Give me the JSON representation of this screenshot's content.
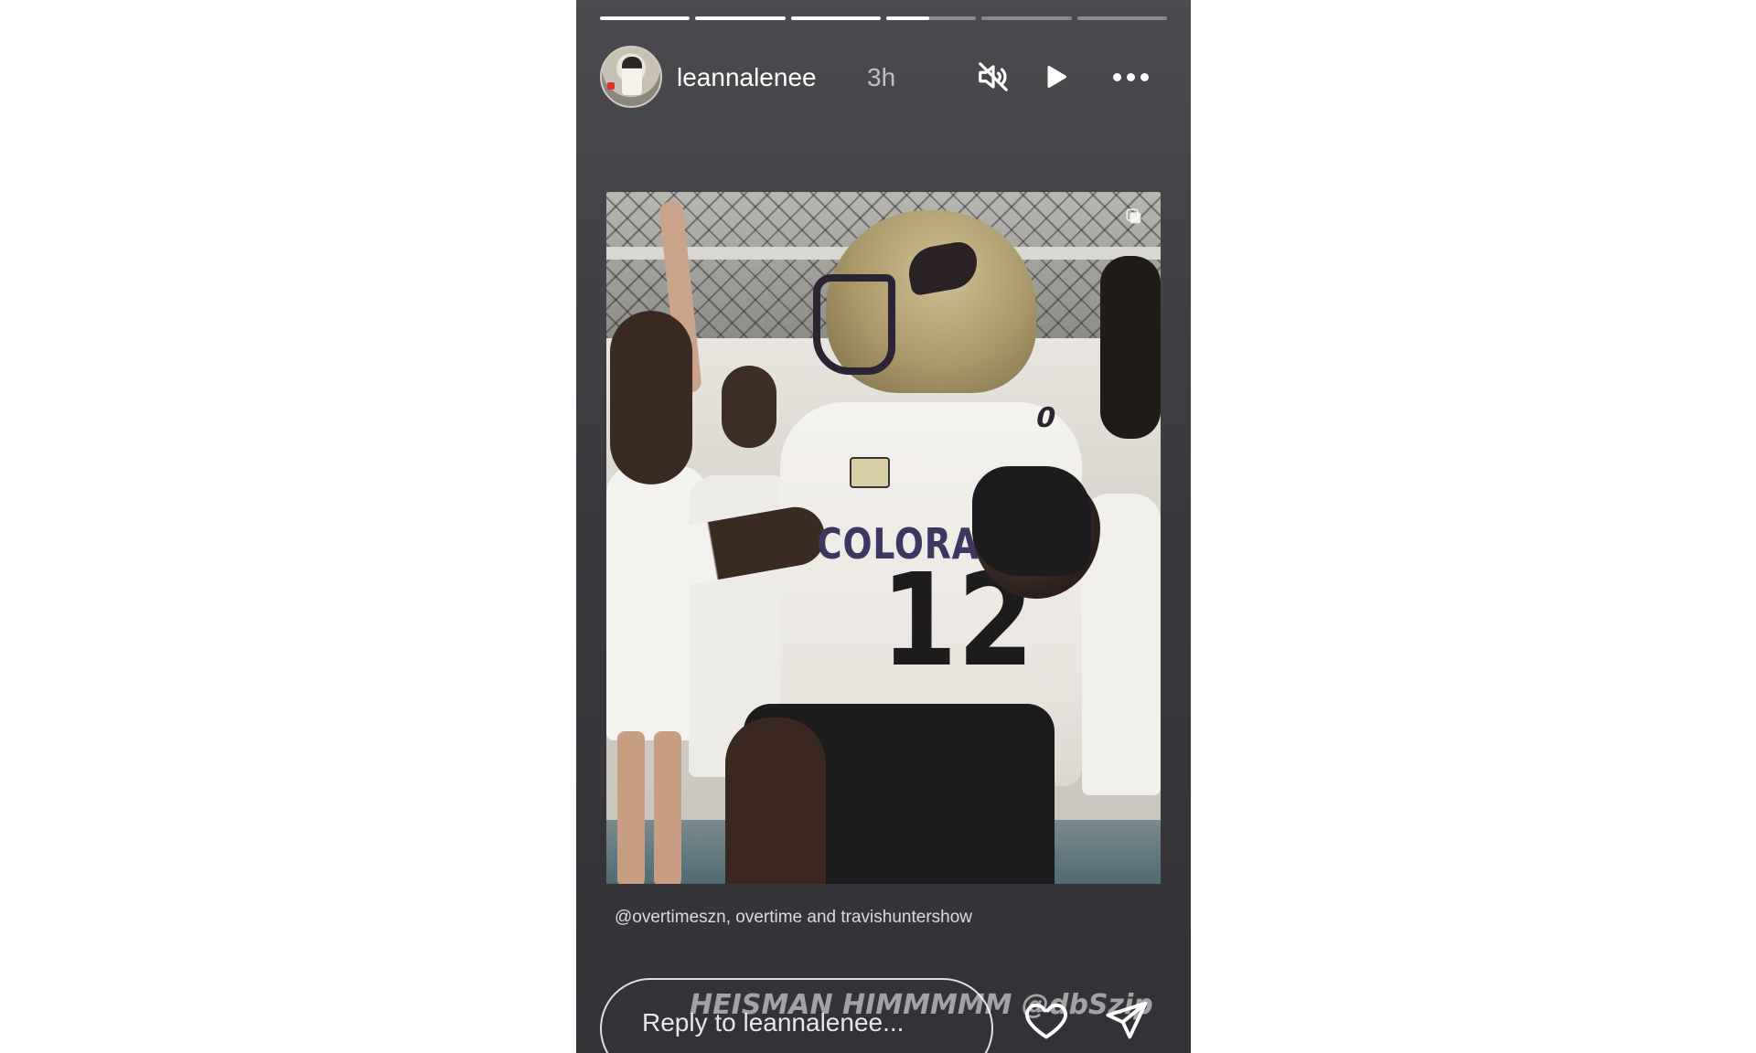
{
  "story": {
    "progress": [
      1,
      1,
      1,
      0.48,
      0,
      0
    ],
    "author": {
      "username": "leannalenee",
      "time": "3h",
      "avatar_icon": "profile-photo"
    },
    "controls": {
      "mute_icon": "speaker-muted-icon",
      "play_icon": "play-icon",
      "more_icon": "more-horizontal-icon"
    },
    "media": {
      "description_icon": "video-still",
      "corner_icon": "copy-square-icon",
      "jersey_text": "COLORA",
      "jersey_number": "12",
      "shoulder_number": "0"
    },
    "credits": "@overtimeszn, overtime and travishuntershow",
    "caption": "HEISMAN HIMMMMM @dbSzip",
    "reply": {
      "placeholder": "Reply to leannalenee..."
    },
    "footer": {
      "like_icon": "heart-outline-icon",
      "share_icon": "paper-plane-icon"
    }
  },
  "colors": {
    "story_bg": "#3b3a3f",
    "text_primary": "#ffffff",
    "text_secondary": "#a8a7ab"
  }
}
